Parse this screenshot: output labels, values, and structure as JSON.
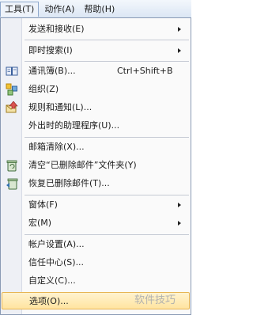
{
  "menubar": {
    "items": [
      {
        "label": "工具(T)",
        "active": true
      },
      {
        "label": "动作(A)",
        "active": false
      },
      {
        "label": "帮助(H)",
        "active": false
      }
    ]
  },
  "menu": {
    "items": [
      {
        "label": "发送和接收(E)",
        "submenu": true
      },
      {
        "label": "即时搜索(I)",
        "submenu": true
      },
      {
        "label": "通讯簿(B)...",
        "shortcut": "Ctrl+Shift+B",
        "icon": "address-book-icon"
      },
      {
        "label": "组织(Z)",
        "icon": "organize-icon"
      },
      {
        "label": "规则和通知(L)...",
        "icon": "rules-icon"
      },
      {
        "label": "外出时的助理程序(U)..."
      },
      {
        "label": "邮箱清除(X)..."
      },
      {
        "label": "清空“已删除邮件”文件夹(Y)",
        "icon": "empty-trash-icon"
      },
      {
        "label": "恢复已删除邮件(T)...",
        "icon": "recover-deleted-icon"
      },
      {
        "label": "窗体(F)",
        "submenu": true
      },
      {
        "label": "宏(M)",
        "submenu": true
      },
      {
        "label": "帐户设置(A)..."
      },
      {
        "label": "信任中心(S)..."
      },
      {
        "label": "自定义(C)..."
      },
      {
        "label": "选项(O)...",
        "highlighted": true
      }
    ]
  },
  "watermark": "软件技巧",
  "colors": {
    "highlight": "#ffe4a0",
    "highlight_border": "#e7b554",
    "gutter": "#eef0f5"
  }
}
